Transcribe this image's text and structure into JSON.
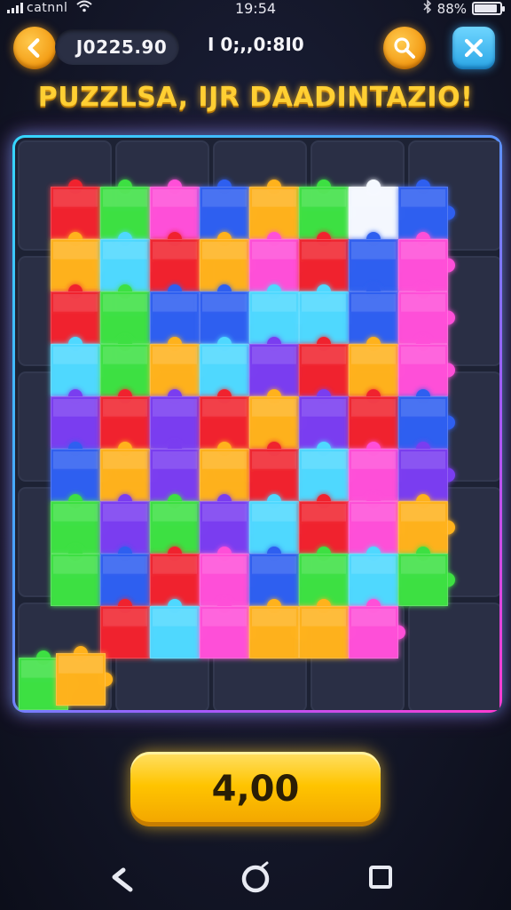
{
  "status_bar": {
    "carrier": "catnnl",
    "time": "19:54",
    "battery_text": "88%",
    "battery_level": 0.88
  },
  "header": {
    "score": "J0225.90",
    "timer": "I 0;,,0:8I0",
    "title": "PUZZLSA, IJR DAADINTAZIO!"
  },
  "icons": {
    "back": "chevron-left-icon",
    "hint": "magnifier-icon",
    "close": "close-icon",
    "nav_back": "back-arrow-icon",
    "nav_home": "home-circle-icon",
    "nav_recent": "square-icon",
    "bluetooth": "bluetooth-icon",
    "wifi": "wifi-icon"
  },
  "board": {
    "rows": 9,
    "cols": 8,
    "colors": {
      "R": "#f0242f",
      "G": "#3ee043",
      "P": "#ff4fd8",
      "B": "#2f5ff0",
      "O": "#ffb21e",
      "C": "#4fd8ff",
      "V": "#7a3df0",
      "W": "#f4f8ff",
      "E": ""
    },
    "grid": [
      [
        "R",
        "G",
        "P",
        "B",
        "O",
        "G",
        "W",
        "B"
      ],
      [
        "O",
        "C",
        "R",
        "O",
        "P",
        "R",
        "B",
        "P"
      ],
      [
        "R",
        "G",
        "B",
        "B",
        "C",
        "C",
        "B",
        "P"
      ],
      [
        "C",
        "G",
        "O",
        "C",
        "V",
        "R",
        "O",
        "P"
      ],
      [
        "V",
        "R",
        "V",
        "R",
        "O",
        "V",
        "R",
        "B"
      ],
      [
        "B",
        "O",
        "V",
        "O",
        "R",
        "C",
        "P",
        "V"
      ],
      [
        "G",
        "V",
        "G",
        "V",
        "C",
        "R",
        "P",
        "O"
      ],
      [
        "G",
        "B",
        "R",
        "P",
        "B",
        "G",
        "C",
        "G"
      ],
      [
        "E",
        "R",
        "C",
        "P",
        "O",
        "O",
        "P",
        "E"
      ]
    ],
    "loose_pieces": [
      "G",
      "O"
    ]
  },
  "confirm_button": {
    "label": "4,00"
  }
}
